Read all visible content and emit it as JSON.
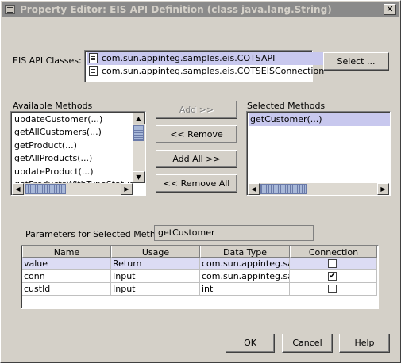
{
  "window": {
    "title": "Property Editor: EIS API Definition (class java.lang.String)",
    "close_glyph": "✕"
  },
  "eis_classes": {
    "label": "EIS API Classes:",
    "items": [
      {
        "label": "com.sun.appinteg.samples.eis.COTSAPI",
        "selected": true
      },
      {
        "label": "com.sun.appinteg.samples.eis.COTSEISConnection",
        "selected": false
      }
    ],
    "select_button": "Select ..."
  },
  "available_methods": {
    "label": "Available Methods",
    "items": [
      "updateCustomer(...)",
      "getAllCustomers(...)",
      "getProduct(...)",
      "getAllProducts(...)",
      "updateProduct(...)",
      "getProductsWithTypeStatus(...)"
    ]
  },
  "transfer_buttons": {
    "add": "Add >>",
    "remove": "<< Remove",
    "add_all": "Add All >>",
    "remove_all": "<< Remove All"
  },
  "selected_methods": {
    "label": "Selected Methods",
    "items": [
      {
        "label": "getCustomer(...)",
        "selected": true
      }
    ]
  },
  "parameters": {
    "label": "Parameters for Selected Method:",
    "method_value": "getCustomer",
    "columns": [
      "Name",
      "Usage",
      "Data Type",
      "Connection"
    ],
    "rows": [
      {
        "name": "value",
        "usage": "Return",
        "data_type": "com.sun.appinteg.sa...",
        "connection": false,
        "selected": true
      },
      {
        "name": "conn",
        "usage": "Input",
        "data_type": "com.sun.appinteg.sa...",
        "connection": true,
        "selected": false
      },
      {
        "name": "custId",
        "usage": "Input",
        "data_type": "int",
        "connection": false,
        "selected": false
      }
    ],
    "check_glyph": "✔"
  },
  "footer": {
    "ok": "OK",
    "cancel": "Cancel",
    "help": "Help"
  },
  "colors": {
    "selection": "#c8c8ee",
    "face": "#d4d0c8"
  }
}
